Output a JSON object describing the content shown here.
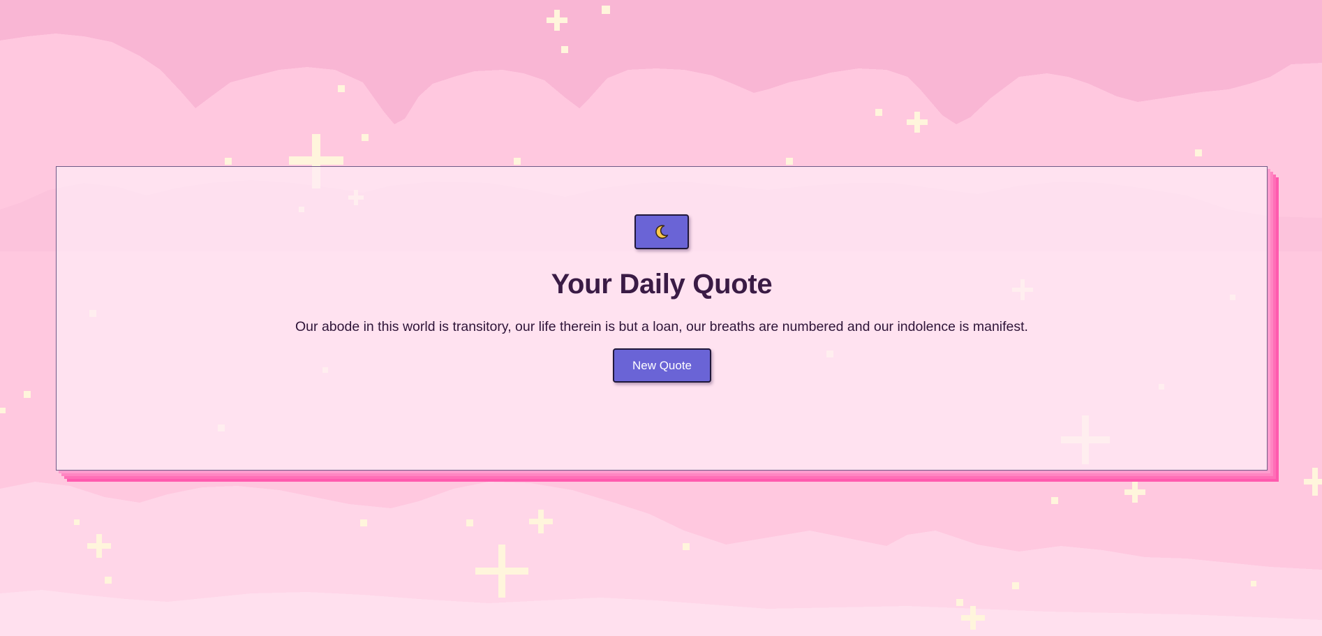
{
  "header": {
    "title": "Your Daily Quote",
    "theme_toggle_icon": "moon-icon"
  },
  "quote": {
    "text": "Our abode in this world is transitory, our life therein is but a loan, our breaths are numbered and our indolence is manifest."
  },
  "actions": {
    "new_quote_label": "New Quote"
  },
  "colors": {
    "background": "#ffc9e0",
    "card_shadow": "#ff6fb7",
    "button": "#6a64d6",
    "title": "#3a1b45",
    "moon": "#ffc94a"
  }
}
